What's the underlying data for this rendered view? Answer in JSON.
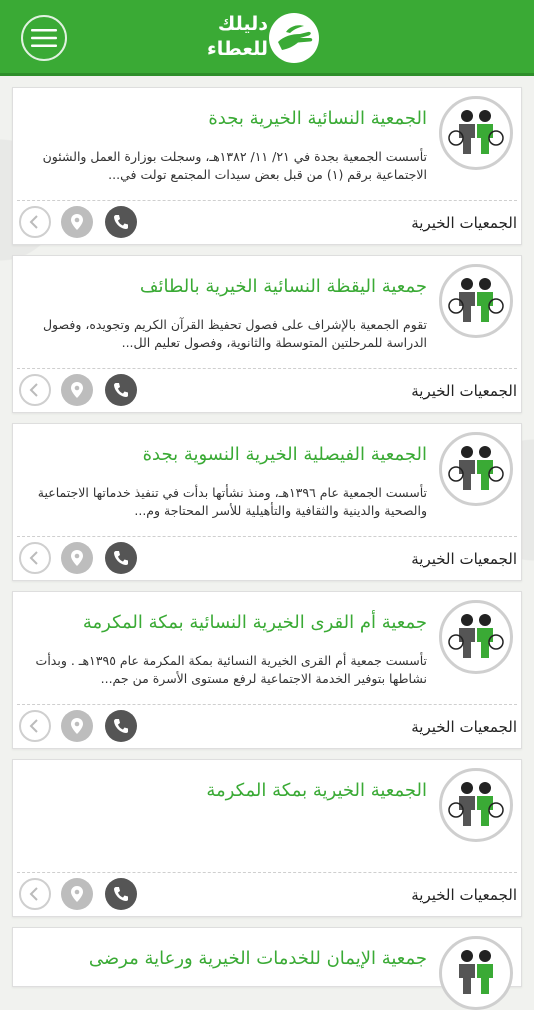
{
  "header": {
    "logo_line1": "دليلك",
    "logo_line2": "للعطاء",
    "brand_color": "#3aaa35"
  },
  "cards": [
    {
      "title": "الجمعية النسائية الخيرية بجدة",
      "description": "تأسست الجمعية بجدة في ٢١/ ١١/ ١٣٨٢هـ، وسجلت بوزارة العمل والشئون الاجتماعية برقم (١) من قبل بعض سيدات المجتمع تولت في...",
      "category": "الجمعيات الخيرية"
    },
    {
      "title": "جمعية اليقظة النسائية الخيرية بالطائف",
      "description": "تقوم الجمعية بالإشراف على فصول تحفيظ القرآن الكريم وتجويده، وفصول الدراسة للمرحلتين المتوسطة والثانوية، وفصول تعليم الل...",
      "category": "الجمعيات الخيرية"
    },
    {
      "title": "الجمعية الفيصلية الخيرية النسوية بجدة",
      "description": "تأسست الجمعية عام ١٣٩٦هـ، ومنذ نشأتها بدأت في تنفيذ خدماتها الاجتماعية والصحية والدينية والثقافية والتأهيلية للأسر المحتاجة وم...",
      "category": "الجمعيات الخيرية"
    },
    {
      "title": "جمعية أم القرى الخيرية النسائية بمكة المكرمة",
      "description": "تأسست جمعية أم القرى الخيرية النسائية بمكة المكرمة عام ١٣٩٥هـ . وبدأت نشاطها بتوفير الخدمة الاجتماعية لرفع مستوى الأسرة من جم...",
      "category": "الجمعيات الخيرية"
    },
    {
      "title": "الجمعية الخيرية بمكة المكرمة",
      "description": "",
      "category": "الجمعيات الخيرية"
    }
  ],
  "partial_card": {
    "title": "جمعية الإيمان للخدمات الخيرية ورعاية مرضى"
  },
  "icons": {
    "menu": "hamburger-icon",
    "avatar": "charity-people-icon",
    "call": "phone-icon",
    "map": "location-pin-icon",
    "back": "chevron-left-icon"
  }
}
